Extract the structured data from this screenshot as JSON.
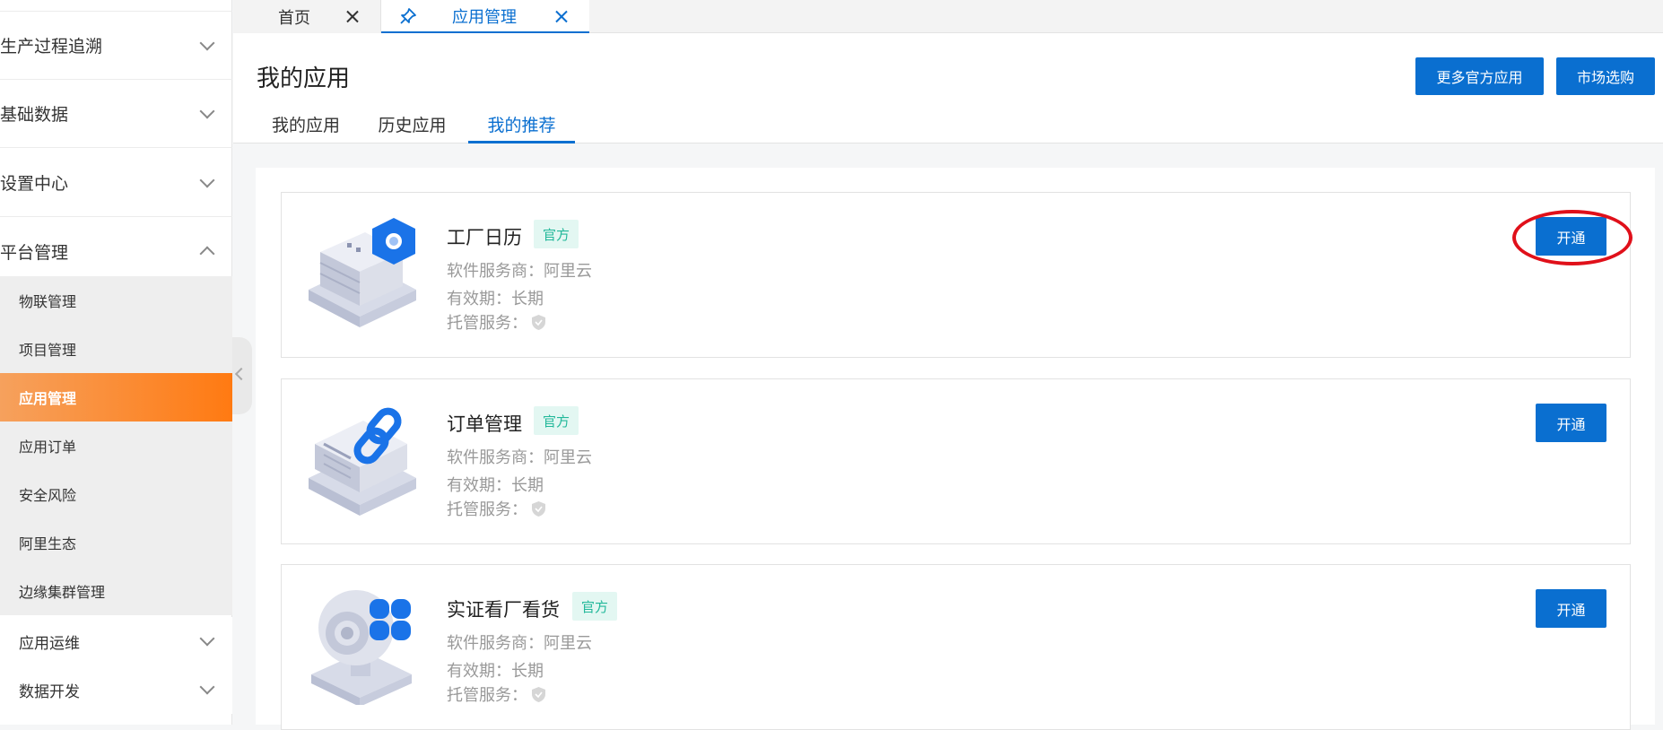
{
  "sidebar": {
    "groups": [
      {
        "label": "生产过程追溯",
        "icon": "chevron-down-icon"
      },
      {
        "label": "基础数据",
        "icon": "chevron-down-icon"
      },
      {
        "label": "设置中心",
        "icon": "chevron-down-icon"
      },
      {
        "label": "平台管理",
        "icon": "chevron-up-icon"
      }
    ],
    "items": [
      {
        "label": "物联管理"
      },
      {
        "label": "项目管理"
      },
      {
        "label": "应用管理",
        "active": true
      },
      {
        "label": "应用订单"
      },
      {
        "label": "安全风险"
      },
      {
        "label": "阿里生态"
      },
      {
        "label": "边缘集群管理"
      }
    ],
    "bottom_groups": [
      {
        "label": "应用运维",
        "icon": "chevron-down-icon"
      },
      {
        "label": "数据开发",
        "icon": "chevron-down-icon"
      }
    ]
  },
  "tabs": [
    {
      "label": "首页"
    },
    {
      "label": "应用管理",
      "active": true
    }
  ],
  "header": {
    "title": "我的应用",
    "buttons": {
      "more": "更多官方应用",
      "market": "市场选购"
    },
    "subtabs": [
      {
        "label": "我的应用"
      },
      {
        "label": "历史应用"
      },
      {
        "label": "我的推荐",
        "active": true
      }
    ]
  },
  "apps": [
    {
      "name": "工厂日历",
      "badge": "官方",
      "vendor": "软件服务商：阿里云",
      "validity": "有效期：长期",
      "hosting": "托管服务：",
      "button": "开通",
      "icon": "calendar-box-icon"
    },
    {
      "name": "订单管理",
      "badge": "官方",
      "vendor": "软件服务商：阿里云",
      "validity": "有效期：长期",
      "hosting": "托管服务：",
      "button": "开通",
      "icon": "chain-link-icon"
    },
    {
      "name": "实证看厂看货",
      "badge": "官方",
      "vendor": "软件服务商：阿里云",
      "validity": "有效期：长期",
      "hosting": "托管服务：",
      "button": "开通",
      "icon": "camera-grid-icon"
    }
  ],
  "colors": {
    "primary": "#0a6fd0",
    "active_menu": "#ff7a12",
    "badge_bg": "#e3f7f2",
    "badge_text": "#22b89a",
    "highlight": "#e0101a"
  }
}
